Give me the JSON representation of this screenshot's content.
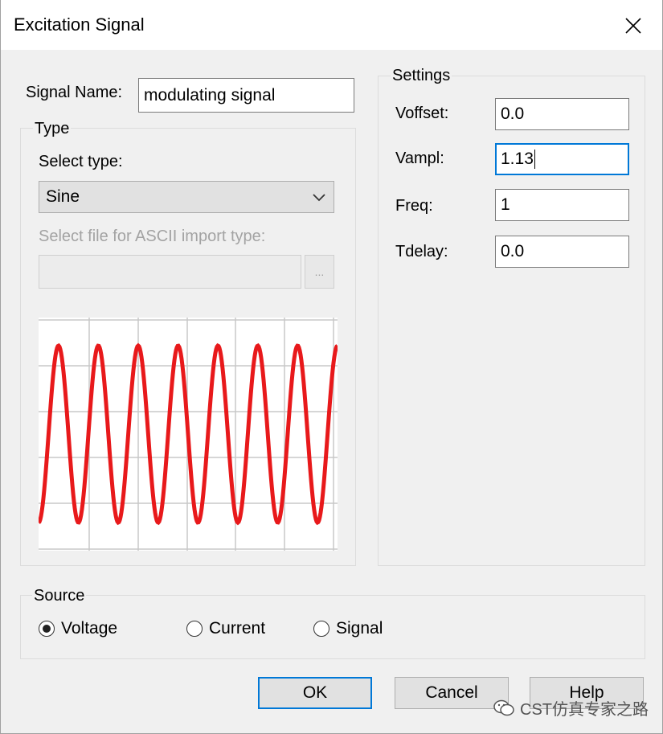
{
  "window": {
    "title": "Excitation Signal"
  },
  "signal_name": {
    "label": "Signal Name:",
    "value": "modulating signal"
  },
  "type_group": {
    "title": "Type",
    "select_label": "Select type:",
    "selected": "Sine",
    "file_label": "Select file for ASCII import type:",
    "file_value": "",
    "browse_label": "..."
  },
  "settings": {
    "title": "Settings",
    "fields": [
      {
        "label": "Voffset:",
        "value": "0.0"
      },
      {
        "label": "Vampl:",
        "value": "1.13"
      },
      {
        "label": "Freq:",
        "value": "1"
      },
      {
        "label": "Tdelay:",
        "value": "0.0"
      }
    ]
  },
  "preview": {
    "cycles": 7.5,
    "color": "#e8191b",
    "grid_color": "#c8c8c8"
  },
  "source": {
    "title": "Source",
    "options": [
      {
        "label": "Voltage",
        "selected": true
      },
      {
        "label": "Current",
        "selected": false
      },
      {
        "label": "Signal",
        "selected": false
      }
    ]
  },
  "buttons": {
    "ok": "OK",
    "cancel": "Cancel",
    "help": "Help"
  },
  "watermark": {
    "text": "CST仿真专家之路"
  }
}
